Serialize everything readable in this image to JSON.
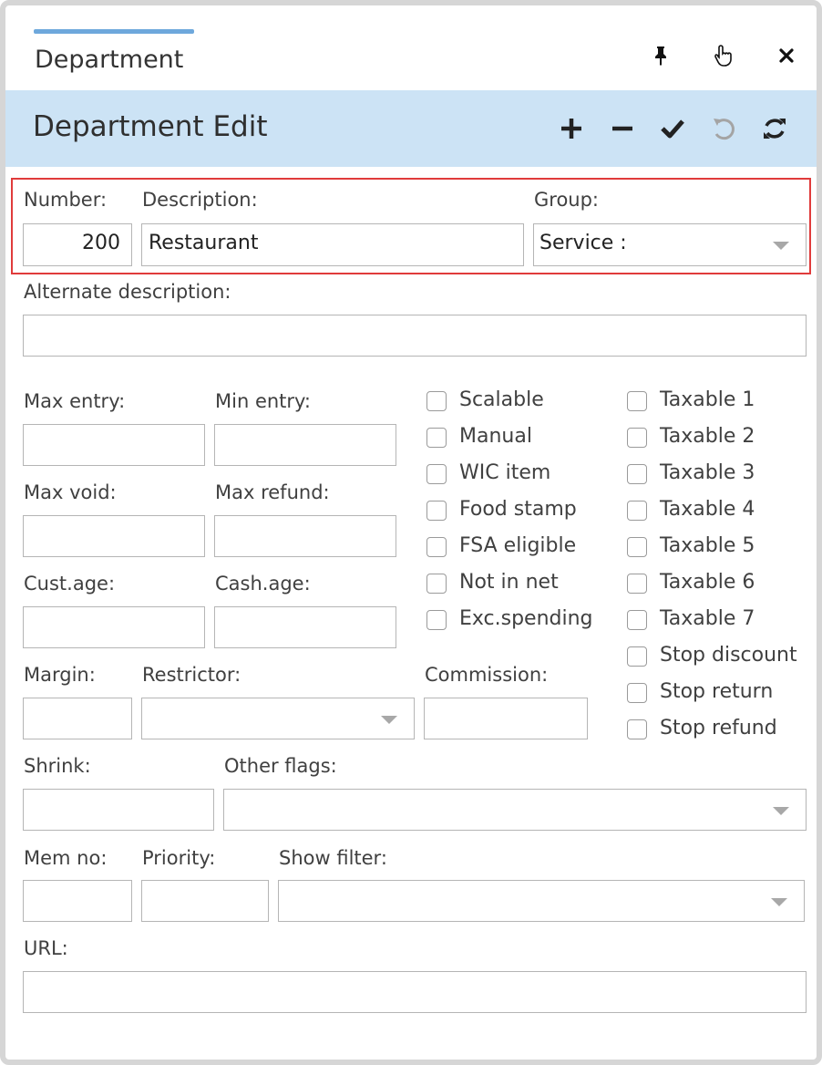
{
  "tab": {
    "title": "Department"
  },
  "window_controls": {
    "pin_icon": "pin-icon",
    "pointer_icon": "hand-pointer-icon",
    "close_icon": "close-icon"
  },
  "header": {
    "title": "Department Edit",
    "actions": [
      "plus-icon",
      "minus-icon",
      "check-icon",
      "undo-icon",
      "refresh-icon"
    ]
  },
  "form": {
    "number": {
      "label": "Number:",
      "value": "200"
    },
    "description": {
      "label": "Description:",
      "value": "Restaurant"
    },
    "group": {
      "label": "Group:",
      "value": "Service :"
    },
    "alt_description": {
      "label": "Alternate description:",
      "value": ""
    },
    "max_entry": {
      "label": "Max entry:",
      "value": ""
    },
    "min_entry": {
      "label": "Min entry:",
      "value": ""
    },
    "max_void": {
      "label": "Max void:",
      "value": ""
    },
    "max_refund": {
      "label": "Max refund:",
      "value": ""
    },
    "cust_age": {
      "label": "Cust.age:",
      "value": ""
    },
    "cash_age": {
      "label": "Cash.age:",
      "value": ""
    },
    "margin": {
      "label": "Margin:",
      "value": ""
    },
    "restrictor": {
      "label": "Restrictor:",
      "value": ""
    },
    "commission": {
      "label": "Commission:",
      "value": ""
    },
    "shrink": {
      "label": "Shrink:",
      "value": ""
    },
    "other_flags": {
      "label": "Other flags:",
      "value": ""
    },
    "mem_no": {
      "label": "Mem no:",
      "value": ""
    },
    "priority": {
      "label": "Priority:",
      "value": ""
    },
    "show_filter": {
      "label": "Show filter:",
      "value": ""
    },
    "url": {
      "label": "URL:",
      "value": ""
    }
  },
  "checkboxes_left": [
    {
      "label": "Scalable",
      "checked": false
    },
    {
      "label": "Manual",
      "checked": false
    },
    {
      "label": "WIC item",
      "checked": false
    },
    {
      "label": "Food stamp",
      "checked": false
    },
    {
      "label": "FSA eligible",
      "checked": false
    },
    {
      "label": "Not in net",
      "checked": false
    },
    {
      "label": "Exc.spending",
      "checked": false
    }
  ],
  "checkboxes_right": [
    {
      "label": "Taxable 1",
      "checked": false
    },
    {
      "label": "Taxable 2",
      "checked": false
    },
    {
      "label": "Taxable 3",
      "checked": false
    },
    {
      "label": "Taxable 4",
      "checked": false
    },
    {
      "label": "Taxable 5",
      "checked": false
    },
    {
      "label": "Taxable 6",
      "checked": false
    },
    {
      "label": "Taxable 7",
      "checked": false
    },
    {
      "label": "Stop discount",
      "checked": false
    },
    {
      "label": "Stop return",
      "checked": false
    },
    {
      "label": "Stop refund",
      "checked": false
    }
  ],
  "colors": {
    "header_bg": "#cce3f5",
    "tab_accent": "#6ea8dc",
    "highlight": "#e03b3b"
  }
}
